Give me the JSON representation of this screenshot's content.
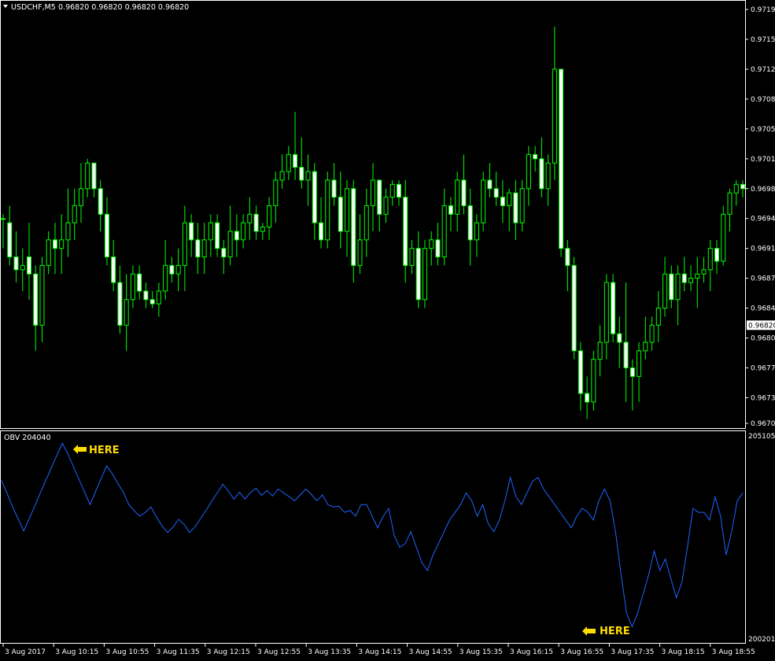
{
  "symbol_header": {
    "title": "USDCHF,M5",
    "ohlc": "0.96820 0.96820 0.96820 0.96820"
  },
  "obv_header": {
    "title": "OBV 204040"
  },
  "price_axis": [
    "0.97190",
    "0.97155",
    "0.97120",
    "0.97085",
    "0.97050",
    "0.97015",
    "0.96980",
    "0.96945",
    "0.96910",
    "0.96875",
    "0.96840",
    "0.96805",
    "0.96770",
    "0.96735",
    "0.96705"
  ],
  "current_price": "0.96820",
  "obv_axis": {
    "max": "205105",
    "min": "200201"
  },
  "time_axis": [
    "3 Aug 2017",
    "3 Aug 10:15",
    "3 Aug 10:55",
    "3 Aug 11:35",
    "3 Aug 12:15",
    "3 Aug 12:55",
    "3 Aug 13:35",
    "3 Aug 14:15",
    "3 Aug 14:55",
    "3 Aug 15:35",
    "3 Aug 16:15",
    "3 Aug 16:55",
    "3 Aug 17:35",
    "3 Aug 18:15",
    "3 Aug 18:55"
  ],
  "annotations": [
    {
      "label": "HERE",
      "position": "obv-peak"
    },
    {
      "label": "HERE",
      "position": "obv-trough"
    }
  ],
  "colors": {
    "background": "#000000",
    "candle": "#00ff00",
    "bull_body": "#000000",
    "bear_body": "#ffffff",
    "obv_line": "#1e64ff",
    "annotation": "#ffdd00",
    "axis_text": "#ffffff",
    "frame": "#ffffff"
  },
  "chart_data": [
    {
      "type": "candlestick",
      "title": "USDCHF,M5",
      "ylim": [
        0.96705,
        0.9719
      ],
      "candles": [
        [
          0.96945,
          0.9695,
          0.9691,
          0.96945
        ],
        [
          0.9694,
          0.9696,
          0.9689,
          0.969
        ],
        [
          0.969,
          0.9693,
          0.9687,
          0.96885
        ],
        [
          0.96885,
          0.9691,
          0.9686,
          0.9689
        ],
        [
          0.969,
          0.9694,
          0.9685,
          0.9688
        ],
        [
          0.9688,
          0.9689,
          0.9679,
          0.9682
        ],
        [
          0.9682,
          0.969,
          0.968,
          0.9689
        ],
        [
          0.9689,
          0.9693,
          0.9688,
          0.9692
        ],
        [
          0.9692,
          0.9694,
          0.9688,
          0.9691
        ],
        [
          0.9691,
          0.9695,
          0.9688,
          0.9692
        ],
        [
          0.9692,
          0.9698,
          0.969,
          0.9694
        ],
        [
          0.9694,
          0.9698,
          0.9692,
          0.9696
        ],
        [
          0.9696,
          0.9701,
          0.9694,
          0.9698
        ],
        [
          0.9698,
          0.97015,
          0.9697,
          0.9701
        ],
        [
          0.9701,
          0.9701,
          0.9697,
          0.9698
        ],
        [
          0.9698,
          0.9699,
          0.9693,
          0.9695
        ],
        [
          0.9695,
          0.9697,
          0.9689,
          0.969
        ],
        [
          0.969,
          0.9692,
          0.9686,
          0.9687
        ],
        [
          0.9687,
          0.9689,
          0.9681,
          0.9682
        ],
        [
          0.9682,
          0.9688,
          0.9679,
          0.9685
        ],
        [
          0.9685,
          0.9689,
          0.9684,
          0.9688
        ],
        [
          0.9688,
          0.9689,
          0.9685,
          0.9686
        ],
        [
          0.9686,
          0.9687,
          0.9684,
          0.9685
        ],
        [
          0.9685,
          0.9686,
          0.9684,
          0.96845
        ],
        [
          0.96845,
          0.9687,
          0.9683,
          0.9686
        ],
        [
          0.9686,
          0.9692,
          0.9685,
          0.9689
        ],
        [
          0.9689,
          0.969,
          0.9687,
          0.9688
        ],
        [
          0.9688,
          0.9691,
          0.9686,
          0.9689
        ],
        [
          0.9689,
          0.9696,
          0.9686,
          0.9694
        ],
        [
          0.9694,
          0.9695,
          0.969,
          0.9692
        ],
        [
          0.9692,
          0.9694,
          0.9688,
          0.969
        ],
        [
          0.969,
          0.9694,
          0.9688,
          0.9692
        ],
        [
          0.9692,
          0.9695,
          0.969,
          0.9694
        ],
        [
          0.9694,
          0.9695,
          0.969,
          0.9691
        ],
        [
          0.9691,
          0.9692,
          0.9688,
          0.969
        ],
        [
          0.969,
          0.9696,
          0.9689,
          0.9693
        ],
        [
          0.9693,
          0.9695,
          0.969,
          0.9692
        ],
        [
          0.9692,
          0.9695,
          0.9691,
          0.9694
        ],
        [
          0.9694,
          0.9697,
          0.9692,
          0.9695
        ],
        [
          0.9695,
          0.9696,
          0.9692,
          0.9693
        ],
        [
          0.9693,
          0.9694,
          0.9692,
          0.96935
        ],
        [
          0.96935,
          0.9697,
          0.9692,
          0.9696
        ],
        [
          0.9696,
          0.97,
          0.9694,
          0.9699
        ],
        [
          0.9699,
          0.9702,
          0.9698,
          0.97
        ],
        [
          0.97,
          0.9703,
          0.9699,
          0.9702
        ],
        [
          0.9702,
          0.9707,
          0.9699,
          0.97005
        ],
        [
          0.97005,
          0.9704,
          0.9698,
          0.9699
        ],
        [
          0.9699,
          0.9702,
          0.9696,
          0.97
        ],
        [
          0.97,
          0.9701,
          0.9692,
          0.9694
        ],
        [
          0.9694,
          0.9697,
          0.9691,
          0.9692
        ],
        [
          0.9692,
          0.97,
          0.9691,
          0.9699
        ],
        [
          0.9699,
          0.9701,
          0.9696,
          0.9697
        ],
        [
          0.9697,
          0.97,
          0.9691,
          0.9693
        ],
        [
          0.9693,
          0.9699,
          0.969,
          0.9698
        ],
        [
          0.9698,
          0.9699,
          0.9687,
          0.9689
        ],
        [
          0.9689,
          0.9695,
          0.9688,
          0.9692
        ],
        [
          0.9692,
          0.9698,
          0.969,
          0.9696
        ],
        [
          0.9696,
          0.9701,
          0.9693,
          0.9699
        ],
        [
          0.9699,
          0.9699,
          0.9693,
          0.9695
        ],
        [
          0.9695,
          0.9698,
          0.9694,
          0.9697
        ],
        [
          0.9697,
          0.9699,
          0.9696,
          0.96985
        ],
        [
          0.96985,
          0.9699,
          0.9696,
          0.9697
        ],
        [
          0.9697,
          0.9699,
          0.9687,
          0.9689
        ],
        [
          0.9689,
          0.9692,
          0.9688,
          0.9691
        ],
        [
          0.9691,
          0.9693,
          0.9684,
          0.9685
        ],
        [
          0.9685,
          0.9692,
          0.9684,
          0.9691
        ],
        [
          0.9691,
          0.9693,
          0.9689,
          0.9692
        ],
        [
          0.9692,
          0.9694,
          0.9689,
          0.969
        ],
        [
          0.969,
          0.9698,
          0.9689,
          0.9696
        ],
        [
          0.9696,
          0.9697,
          0.9693,
          0.9695
        ],
        [
          0.9695,
          0.97,
          0.9693,
          0.9699
        ],
        [
          0.9699,
          0.9702,
          0.9695,
          0.9696
        ],
        [
          0.9696,
          0.9698,
          0.9689,
          0.9692
        ],
        [
          0.9692,
          0.9695,
          0.969,
          0.9694
        ],
        [
          0.9694,
          0.97,
          0.9693,
          0.9699
        ],
        [
          0.9699,
          0.9701,
          0.9697,
          0.9698
        ],
        [
          0.9698,
          0.97,
          0.9696,
          0.9697
        ],
        [
          0.9697,
          0.9699,
          0.9694,
          0.9696
        ],
        [
          0.9696,
          0.9698,
          0.9693,
          0.96975
        ],
        [
          0.96975,
          0.9699,
          0.9692,
          0.9694
        ],
        [
          0.9694,
          0.9699,
          0.9693,
          0.9698
        ],
        [
          0.9698,
          0.9703,
          0.9696,
          0.9702
        ],
        [
          0.9702,
          0.9703,
          0.97,
          0.97015
        ],
        [
          0.97015,
          0.9704,
          0.9697,
          0.9698
        ],
        [
          0.9698,
          0.9702,
          0.9696,
          0.9701
        ],
        [
          0.9701,
          0.9717,
          0.9699,
          0.9712
        ],
        [
          0.9712,
          0.9712,
          0.969,
          0.9691
        ],
        [
          0.9691,
          0.9692,
          0.9686,
          0.9689
        ],
        [
          0.9689,
          0.969,
          0.9678,
          0.9679
        ],
        [
          0.9679,
          0.968,
          0.9672,
          0.9674
        ],
        [
          0.9674,
          0.9676,
          0.9671,
          0.9673
        ],
        [
          0.9673,
          0.9679,
          0.9672,
          0.9678
        ],
        [
          0.9678,
          0.9682,
          0.9676,
          0.968
        ],
        [
          0.968,
          0.9688,
          0.9678,
          0.9687
        ],
        [
          0.9687,
          0.9688,
          0.968,
          0.9681
        ],
        [
          0.9681,
          0.9683,
          0.9677,
          0.968
        ],
        [
          0.968,
          0.9687,
          0.9673,
          0.9677
        ],
        [
          0.9677,
          0.9678,
          0.9672,
          0.9676
        ],
        [
          0.9676,
          0.968,
          0.9673,
          0.9679
        ],
        [
          0.9679,
          0.9683,
          0.9678,
          0.968
        ],
        [
          0.968,
          0.9683,
          0.9679,
          0.9682
        ],
        [
          0.9682,
          0.9686,
          0.968,
          0.9684
        ],
        [
          0.9684,
          0.969,
          0.9683,
          0.9688
        ],
        [
          0.9688,
          0.9689,
          0.9684,
          0.9685
        ],
        [
          0.9685,
          0.9689,
          0.9682,
          0.9688
        ],
        [
          0.9688,
          0.969,
          0.9686,
          0.9687
        ],
        [
          0.9687,
          0.9689,
          0.9686,
          0.96875
        ],
        [
          0.96875,
          0.969,
          0.9684,
          0.9688
        ],
        [
          0.9688,
          0.969,
          0.9687,
          0.96885
        ],
        [
          0.96885,
          0.9692,
          0.9686,
          0.9691
        ],
        [
          0.9691,
          0.9692,
          0.9688,
          0.96895
        ],
        [
          0.96895,
          0.9696,
          0.9689,
          0.9695
        ],
        [
          0.9695,
          0.9698,
          0.9693,
          0.96975
        ],
        [
          0.96975,
          0.9699,
          0.9696,
          0.96985
        ],
        [
          0.96985,
          0.9699,
          0.9697,
          0.9698
        ]
      ]
    },
    {
      "type": "line",
      "title": "OBV 204040",
      "ylim": [
        200201,
        205105
      ],
      "series": [
        {
          "values": [
            204120,
            203790,
            203440,
            203130,
            202820,
            203140,
            203460,
            203800,
            204120,
            204450,
            204770,
            205080,
            204800,
            204470,
            204150,
            203820,
            203500,
            203840,
            204170,
            204500,
            204300,
            204050,
            203820,
            203500,
            203340,
            203200,
            203300,
            203440,
            203180,
            202950,
            202780,
            202920,
            203120,
            202990,
            202780,
            202930,
            203150,
            203360,
            203590,
            203800,
            204020,
            203850,
            203640,
            203820,
            203640,
            203810,
            203920,
            203740,
            203860,
            203720,
            203900,
            203800,
            203700,
            203600,
            203750,
            203900,
            203760,
            203600,
            203750,
            203500,
            203440,
            203460,
            203300,
            203350,
            203200,
            203500,
            203500,
            203200,
            202900,
            203200,
            203400,
            202700,
            202400,
            202500,
            202800,
            202400,
            202000,
            201800,
            202200,
            202500,
            202800,
            203100,
            203300,
            203500,
            203800,
            203600,
            203200,
            203500,
            203000,
            202800,
            203100,
            203600,
            204200,
            203700,
            203500,
            203800,
            204100,
            204200,
            203900,
            203700,
            203500,
            203300,
            203100,
            202900,
            203200,
            203400,
            203300,
            203100,
            203600,
            203900,
            203600,
            202800,
            201700,
            200700,
            200350,
            200700,
            201200,
            201700,
            202300,
            201800,
            202100,
            201600,
            201100,
            201500,
            202400,
            203400,
            203300,
            203300,
            203100,
            203700,
            203200,
            202200,
            202800,
            203600,
            203800
          ]
        }
      ]
    }
  ]
}
